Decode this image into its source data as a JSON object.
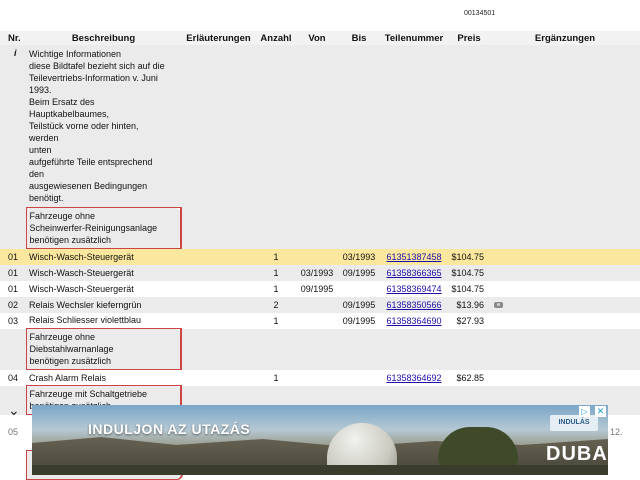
{
  "doc_number": "00134501",
  "headers": {
    "nr": "Nr.",
    "beschreibung": "Beschreibung",
    "erlaeuterungen": "Erläuterungen",
    "anzahl": "Anzahl",
    "von": "Von",
    "bis": "Bis",
    "teilenummer": "Teilenummer",
    "preis": "Preis",
    "ergaenzungen": "Ergänzungen"
  },
  "info": {
    "nr": "i",
    "lines": [
      "Wichtige Informationen",
      "diese Bildtafel bezieht sich auf die",
      "Teilevertriebs-Information v. Juni",
      "1993.",
      "Beim Ersatz des",
      "Hauptkabelbaumes,",
      "Teilstück vorne oder hinten,",
      "werden",
      "unten",
      "aufgeführte Teile entsprechend",
      "den",
      "ausgewiesenen Bedingungen",
      "benötigt."
    ]
  },
  "note1": {
    "lines": [
      "Fahrzeuge ohne",
      "Scheinwerfer-Reinigungsanlage",
      "benötigen zusätzlich"
    ]
  },
  "rows1": [
    {
      "nr": "01",
      "beschreibung": "Wisch-Wasch-Steuergerät",
      "anzahl": "1",
      "von": "",
      "bis": "03/1993",
      "teilenummer": "61351387458",
      "preis": "$104.75"
    },
    {
      "nr": "01",
      "beschreibung": "Wisch-Wasch-Steuergerät",
      "anzahl": "1",
      "von": "03/1993",
      "bis": "09/1995",
      "teilenummer": "61358366365",
      "preis": "$104.75"
    },
    {
      "nr": "01",
      "beschreibung": "Wisch-Wasch-Steuergerät",
      "anzahl": "1",
      "von": "09/1995",
      "bis": "",
      "teilenummer": "61358369474",
      "preis": "$104.75"
    },
    {
      "nr": "02",
      "beschreibung": "Relais Wechsler kieferngrün",
      "anzahl": "2",
      "von": "",
      "bis": "09/1995",
      "teilenummer": "61358350566",
      "preis": "$13.96"
    },
    {
      "nr": "03",
      "beschreibung": "Relais Schliesser violettblau",
      "anzahl": "1",
      "von": "",
      "bis": "09/1995",
      "teilenummer": "61358364690",
      "preis": "$27.93"
    }
  ],
  "note2": {
    "lines": [
      "Fahrzeuge ohne",
      "Diebstahlwarnanlage",
      "benötigen zusätzlich"
    ]
  },
  "rows2": [
    {
      "nr": "04",
      "beschreibung": "Crash Alarm Relais",
      "anzahl": "1",
      "von": "",
      "bis": "",
      "teilenummer": "61358364692",
      "preis": "$62.85"
    }
  ],
  "note3": {
    "lines": [
      "Fahrzeuge mit Schaltgetriebe",
      "benötigen zusätzlich"
    ]
  },
  "under_ad": {
    "nr": "05",
    "right": "12."
  },
  "ad": {
    "headline": "INDULJON AZ UTAZÁS",
    "cta": "INDULÁS",
    "brand": "DUBAI",
    "adchoice_icon": "▷",
    "close_icon": "✕"
  }
}
